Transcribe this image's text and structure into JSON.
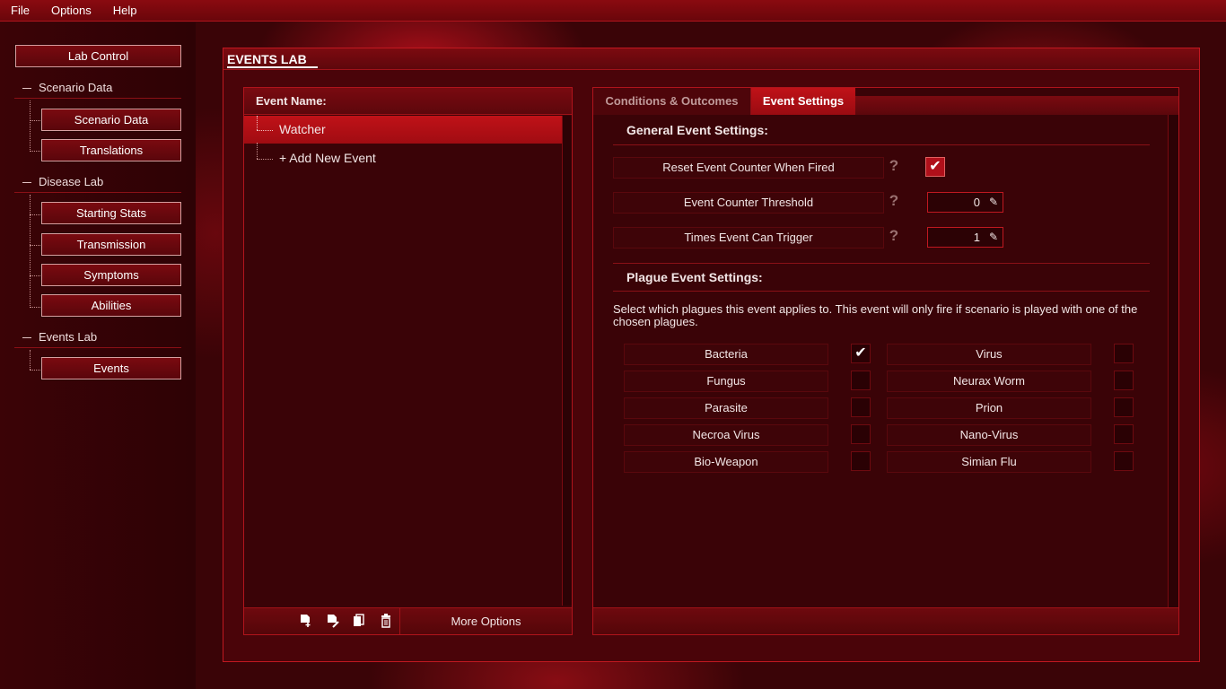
{
  "menu": [
    "File",
    "Options",
    "Help"
  ],
  "sidebar": {
    "lab_control": "Lab Control",
    "sections": [
      {
        "title": "Scenario Data",
        "items": [
          "Scenario Data",
          "Translations"
        ]
      },
      {
        "title": "Disease Lab",
        "items": [
          "Starting Stats",
          "Transmission",
          "Symptoms",
          "Abilities"
        ]
      },
      {
        "title": "Events Lab",
        "items": [
          "Events"
        ]
      }
    ]
  },
  "main": {
    "title": "EVENTS LAB",
    "event_list": {
      "header": "Event Name:",
      "items": [
        "Watcher",
        "+ Add New Event"
      ],
      "selected_index": 0,
      "more_options": "More Options",
      "footer_icons": [
        "add-file-icon",
        "edit-file-icon",
        "copy-icon",
        "trash-icon"
      ]
    },
    "tabs": [
      "Conditions & Outcomes",
      "Event Settings"
    ],
    "active_tab": "Event Settings",
    "general": {
      "heading": "General Event Settings:",
      "reset_counter": {
        "label": "Reset Event Counter When Fired",
        "checked": true
      },
      "threshold": {
        "label": "Event Counter Threshold",
        "value": "0"
      },
      "times_trigger": {
        "label": "Times Event Can Trigger",
        "value": "1"
      },
      "help": "?"
    },
    "plague": {
      "heading": "Plague Event Settings:",
      "description": "Select which plagues this event applies to. This event will only fire if scenario is played with one of the chosen plagues.",
      "left": [
        {
          "name": "Bacteria",
          "checked": true
        },
        {
          "name": "Fungus",
          "checked": false
        },
        {
          "name": "Parasite",
          "checked": false
        },
        {
          "name": "Necroa Virus",
          "checked": false
        },
        {
          "name": "Bio-Weapon",
          "checked": false
        }
      ],
      "right": [
        {
          "name": "Virus",
          "checked": false
        },
        {
          "name": "Neurax Worm",
          "checked": false
        },
        {
          "name": "Prion",
          "checked": false
        },
        {
          "name": "Nano-Virus",
          "checked": false
        },
        {
          "name": "Simian Flu",
          "checked": false
        }
      ]
    }
  },
  "colors": {
    "accent": "#c01218",
    "background": "#3a0407",
    "border": "#b0141c"
  }
}
